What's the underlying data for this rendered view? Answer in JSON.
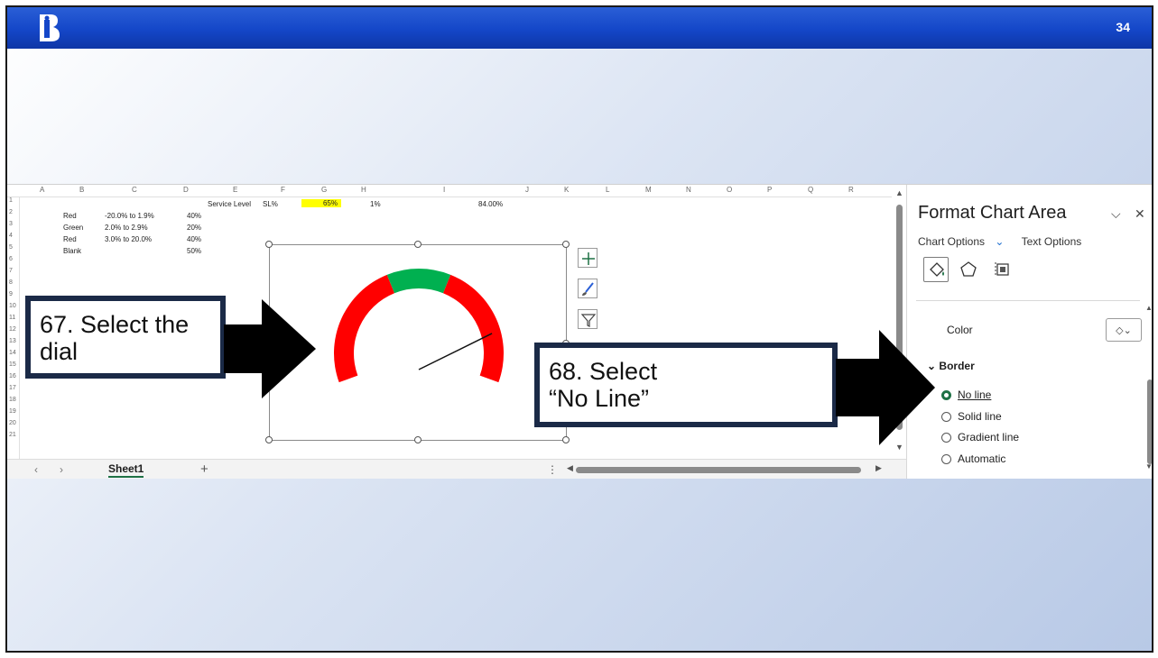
{
  "slide": {
    "number": "34",
    "logo_icon": "bi-logo-icon",
    "banner_color": "#1446c8"
  },
  "spreadsheet": {
    "columns": [
      "A",
      "B",
      "C",
      "D",
      "E",
      "F",
      "G",
      "H",
      "I",
      "J",
      "K",
      "L",
      "M",
      "N",
      "O",
      "P",
      "Q",
      "R"
    ],
    "rows": [
      "1",
      "2",
      "3",
      "4",
      "5",
      "6",
      "7",
      "8",
      "9",
      "10",
      "11",
      "12",
      "13",
      "14",
      "15",
      "16",
      "17",
      "18",
      "19",
      "20",
      "21"
    ],
    "cells": {
      "e1": "Service Level",
      "f1": "SL%",
      "g1": "65%",
      "h1": "1%",
      "i1": "84.00%",
      "b2": "Red",
      "c2": "-20.0% to 1.9%",
      "d2": "40%",
      "b3": "Green",
      "c3": "2.0% to 2.9%",
      "d3": "20%",
      "b4": "Red",
      "c4": "3.0% to 20.0%",
      "d4": "40%",
      "b5": "Blank",
      "d5": "50%"
    },
    "sheet_tab": "Sheet1",
    "highlight_color": "#ffff00"
  },
  "gauge": {
    "segments": [
      {
        "label": "Red",
        "value": 40,
        "color": "#ff0000"
      },
      {
        "label": "Green",
        "value": 20,
        "color": "#00b050"
      },
      {
        "label": "Red",
        "value": 40,
        "color": "#ff0000"
      }
    ],
    "needle_value": 84
  },
  "format_pane": {
    "title": "Format Chart Area",
    "tab_chart_options": "Chart Options",
    "tab_text_options": "Text Options",
    "color_label": "Color",
    "border_heading": "Border",
    "options": [
      "No line",
      "Solid line",
      "Gradient line",
      "Automatic"
    ],
    "selected_option": "No line",
    "accent_color": "#1e7145"
  },
  "callouts": {
    "left_line1": "67. Select the",
    "left_line2": "dial",
    "right_line1": "68. Select",
    "right_line2": "“No Line”",
    "border_color": "#1b2a47"
  }
}
